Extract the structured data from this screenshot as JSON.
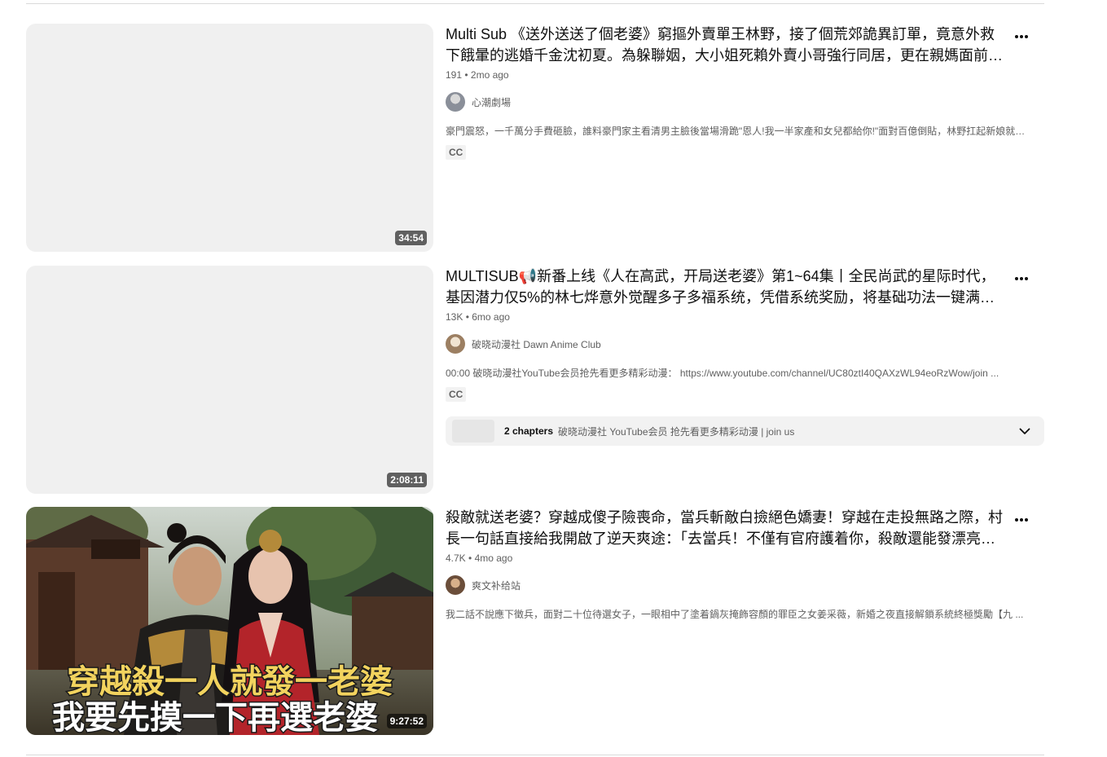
{
  "videos": [
    {
      "title": "Multi Sub 《送外送送了個老婆》窮摳外賣單王林野，接了個荒郊詭異訂單，竟意外救下餓暈的逃婚千金沈初夏。為躲聯姻，大小姐死賴外賣小哥強行同居，更在親媽面前…",
      "views": "191",
      "age": "2mo ago",
      "channel": "心潮劇場",
      "description": "豪門震怒，一千萬分手費砸臉，誰料豪門家主看清男主臉後當場滑跪\"恩人!我一半家產和女兒都給你!\"面對百億倒貼，林野扛起新娘就 ...",
      "badge": "CC",
      "duration": "34:54",
      "avatar_color": "#8a8f99"
    },
    {
      "title": "MULTISUB📢新番上线《人在高武，开局送老婆》第1~64集丨全民尚武的星际时代，基因潜力仅5%的林七烨意外觉醒多子多福系统，凭借系统奖励，将基础功法一键满…",
      "views": "13K",
      "age": "6mo ago",
      "channel": "破晓动漫社 Dawn Anime Club",
      "description": "00:00 破晓动漫社YouTube会员抢先看更多精彩动漫： https://www.youtube.com/channel/UC80ztI40QAXzWL94eoRzWow/join ...",
      "badge": "CC",
      "duration": "2:08:11",
      "avatar_color": "#b8a590",
      "chapters": {
        "count": "2 chapters",
        "text": "破晓动漫社 YouTube会员 抢先看更多精彩动漫 | join us"
      }
    },
    {
      "title": "殺敵就送老婆？穿越成傻子險喪命，當兵斬敵白撿絕色嬌妻！穿越在走投無路之際，村長一句話直接給我開啟了逆天爽途：「去當兵！不僅有官府護着你，殺敵還能發漂亮…",
      "views": "4.7K",
      "age": "4mo ago",
      "channel": "爽文补给站",
      "description": "我二話不說應下徵兵，面對二十位待選女子，一眼相中了塗着鍋灰掩飾容顏的罪臣之女姜采薇，新婚之夜直接解鎖系統終極獎勵【九 ...",
      "duration": "9:27:52",
      "avatar_color": "#6b4e3a",
      "thumbnail_caption_line1": "穿越殺一人就發一老婆",
      "thumbnail_caption_line2": "我要先摸一下再選老婆"
    }
  ]
}
